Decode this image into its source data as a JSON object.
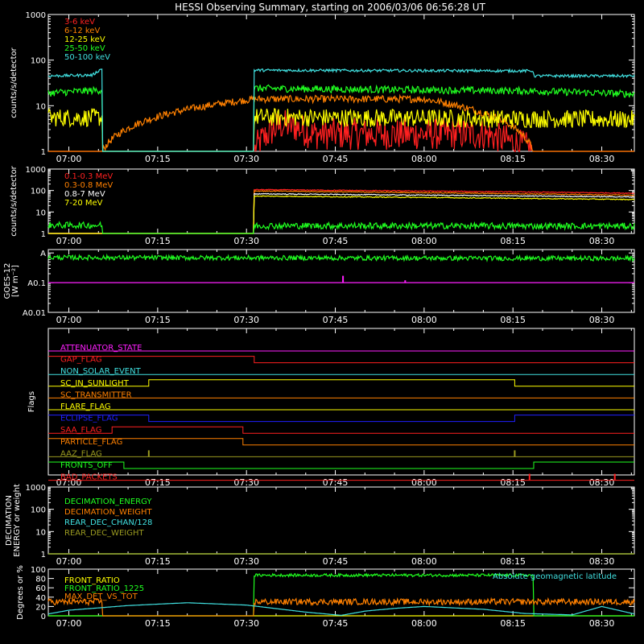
{
  "title": "HESSI Observing Summary, starting on 2006/03/06 06:56:28 UT",
  "x_axis": {
    "tick_labels": [
      "07:00",
      "07:15",
      "07:30",
      "07:45",
      "08:00",
      "08:15",
      "08:30"
    ],
    "tick_minutes": [
      0,
      15,
      30,
      45,
      60,
      75,
      90
    ],
    "range_minutes": [
      -3.47,
      95.5
    ]
  },
  "colors": {
    "red": "#ff2020",
    "orange": "#ff8000",
    "yellow": "#ffff00",
    "green": "#20ff20",
    "cyan": "#40e0e0",
    "magenta": "#ff20ff",
    "blue": "#2020ff",
    "olive": "#9a9a20",
    "white": "#ffffff",
    "salmon": "#ff7070"
  },
  "chart_data": [
    {
      "type": "line",
      "name": "lightcurves-low",
      "ylabel": "counts/s/detector",
      "yscale": "log",
      "ylim": [
        1,
        1000
      ],
      "ytick_labels": [
        "1",
        "10",
        "100",
        "1000"
      ],
      "ytick_values": [
        1,
        10,
        100,
        1000
      ],
      "series": [
        {
          "name": "3-6 keV",
          "color": "red",
          "x": [
            -3.47,
            5.6,
            31.3,
            36,
            38,
            41,
            46,
            60,
            70,
            78.5
          ],
          "y": [
            1,
            1,
            1,
            3.8,
            3.5,
            2.4,
            2.4,
            2.4,
            2.4,
            1
          ],
          "noise": 0.35
        },
        {
          "name": "6-12 keV",
          "color": "orange",
          "x": [
            -3.47,
            5.6,
            31.3,
            40,
            60,
            78.5
          ],
          "y": [
            1,
            1,
            14,
            14,
            14,
            1
          ],
          "noise": 0.08
        },
        {
          "name": "12-25 keV",
          "color": "yellow",
          "x": [
            -3.47,
            5.6,
            5.6,
            31.3,
            31.3,
            95.5
          ],
          "y": [
            5.5,
            5.5,
            1,
            1,
            5.6,
            5
          ],
          "noise": 0.2
        },
        {
          "name": "25-50 keV",
          "color": "green",
          "x": [
            -3.47,
            5.6,
            5.6,
            31.3,
            31.3,
            78.5,
            95.5
          ],
          "y": [
            19,
            22,
            1,
            1,
            24,
            21,
            18
          ],
          "noise": 0.08
        },
        {
          "name": "50-100 keV",
          "color": "cyan",
          "x": [
            -3.47,
            4,
            5.6,
            5.6,
            31.3,
            31.3,
            78.5,
            78.5,
            95.5
          ],
          "y": [
            45,
            47,
            65,
            1,
            1,
            60,
            58,
            45,
            45
          ],
          "noise": 0.03
        }
      ]
    },
    {
      "type": "line",
      "name": "lightcurves-high",
      "ylabel": "counts/s/detector",
      "yscale": "log",
      "ylim": [
        1,
        1000
      ],
      "ytick_labels": [
        "1",
        "10",
        "100",
        "1000"
      ],
      "ytick_values": [
        1,
        10,
        100,
        1000
      ],
      "series": [
        {
          "name": "0.1-0.3 MeV",
          "color": "red",
          "x": [
            -3.47,
            31.3,
            31.3,
            95.5
          ],
          "y": [
            1,
            1,
            110,
            75
          ],
          "noise": 0.02
        },
        {
          "name": "0.3-0.8 MeV",
          "color": "orange",
          "x": [
            -3.47,
            31.3,
            31.3,
            95.5
          ],
          "y": [
            1,
            1,
            95,
            60
          ],
          "noise": 0.02
        },
        {
          "name": "0.8-7 MeV",
          "color": "white",
          "x": [
            -3.47,
            31.3,
            31.3,
            95.5
          ],
          "y": [
            1,
            1,
            70,
            50
          ],
          "noise": 0.02
        },
        {
          "name": "7-20 MeV",
          "color": "yellow",
          "x": [
            -3.47,
            31.3,
            31.3,
            95.5
          ],
          "y": [
            1,
            1,
            55,
            38
          ],
          "noise": 0.02
        },
        {
          "name": "",
          "color": "green",
          "x": [
            -3.47,
            5.6,
            5.6,
            31.3,
            31.3,
            95.5
          ],
          "y": [
            2.4,
            2.4,
            1,
            1,
            2.3,
            2.2
          ],
          "noise": 0.15
        }
      ]
    },
    {
      "type": "line",
      "name": "goes",
      "ylabel": "GOES-12",
      "ylabel2": "[W m⁻²]",
      "yscale": "log",
      "ylim": [
        0.01,
        1.3
      ],
      "ytick_labels": [
        "A0.01",
        "A0.1",
        "A"
      ],
      "ytick_values": [
        0.01,
        0.1,
        1
      ],
      "series": [
        {
          "name": "",
          "color": "green",
          "x": [
            -3.47,
            95.5
          ],
          "y": [
            0.7,
            0.65
          ],
          "noise": 0.08
        },
        {
          "name": "",
          "color": "magenta",
          "x": [
            -3.47,
            95.5
          ],
          "y": [
            0.1,
            0.1
          ],
          "noise": 0
        }
      ],
      "spikes": [
        {
          "color": "magenta",
          "x": 46.3,
          "y0": 0.1,
          "y1": 0.17
        },
        {
          "color": "magenta",
          "x": 56.8,
          "y0": 0.1,
          "y1": 0.12
        }
      ]
    },
    {
      "type": "line",
      "name": "flags",
      "ylabel": "Flags",
      "flags": [
        {
          "name": "ATTENUATOR_STATE",
          "color": "magenta",
          "x": [
            -3.47,
            95.5
          ],
          "s": [
            0,
            0
          ],
          "spikes": []
        },
        {
          "name": "GAP_FLAG",
          "color": "red",
          "x": [
            -3.47,
            31.3,
            31.3,
            95.5
          ],
          "s": [
            1,
            1,
            0,
            0
          ],
          "spikes": []
        },
        {
          "name": "NON_SOLAR_EVENT",
          "color": "cyan",
          "x": [
            -3.47,
            95.5
          ],
          "s": [
            0,
            0
          ],
          "spikes": []
        },
        {
          "name": "SC_IN_SUNLIGHT",
          "color": "yellow",
          "x": [
            -3.47,
            13.5,
            13.5,
            75.3,
            75.3,
            95.5
          ],
          "s": [
            0,
            0,
            1,
            1,
            0,
            0
          ],
          "spikes": []
        },
        {
          "name": "SC_TRANSMITTER",
          "color": "orange",
          "x": [
            -3.47,
            95.5
          ],
          "s": [
            0,
            0
          ],
          "spikes": []
        },
        {
          "name": "FLARE_FLAG",
          "color": "yellow",
          "x": [
            -3.47,
            95.5
          ],
          "s": [
            0,
            0
          ],
          "spikes": []
        },
        {
          "name": "ECLIPSE_FLAG",
          "color": "blue",
          "x": [
            -3.47,
            13.5,
            13.5,
            75.3,
            75.3,
            95.5
          ],
          "s": [
            1,
            1,
            0,
            0,
            1,
            1
          ],
          "spikes": []
        },
        {
          "name": "SAA_FLAG",
          "color": "red",
          "x": [
            -3.47,
            7.3,
            7.3,
            29.4,
            29.4,
            95.5
          ],
          "s": [
            0,
            0,
            1,
            1,
            0,
            0
          ],
          "spikes": []
        },
        {
          "name": "PARTICLE_FLAG",
          "color": "orange",
          "x": [
            -3.47,
            29.4,
            29.4,
            95.5
          ],
          "s": [
            1,
            1,
            0,
            0
          ],
          "spikes": []
        },
        {
          "name": "AAZ_FLAG",
          "color": "olive",
          "x": [
            -3.47,
            95.5
          ],
          "s": [
            0,
            0
          ],
          "spikes": [
            13.5,
            75.3
          ]
        },
        {
          "name": "FRONTS_OFF",
          "color": "green",
          "x": [
            -3.47,
            9.3,
            9.3,
            78.5,
            78.5,
            95.5
          ],
          "s": [
            1,
            1,
            0,
            0,
            1,
            1
          ],
          "spikes": []
        },
        {
          "name": "BAD_PACKETS",
          "color": "red",
          "x": [
            -3.47,
            95.5
          ],
          "s": [
            0,
            0
          ],
          "spikes": [
            77.8,
            92.2
          ]
        }
      ]
    },
    {
      "type": "line",
      "name": "decimation",
      "ylabel": "DECIMATION",
      "ylabel2": "ENERGY or weight",
      "yscale": "log",
      "ylim": [
        1,
        1000
      ],
      "ytick_labels": [
        "1",
        "10",
        "100",
        "1000"
      ],
      "ytick_values": [
        1,
        10,
        100,
        1000
      ],
      "series": [
        {
          "name": "DECIMATION_ENERGY",
          "color": "green",
          "x": [
            -3.47,
            95.5
          ],
          "y": [
            1,
            1
          ],
          "noise": 0
        },
        {
          "name": "DECIMATION_WEIGHT",
          "color": "orange",
          "x": [
            -3.47,
            95.5
          ],
          "y": [
            1,
            1
          ],
          "noise": 0
        },
        {
          "name": "REAR_DEC_CHAN/128",
          "color": "cyan",
          "x": [
            -3.47,
            95.5
          ],
          "y": [
            1,
            1
          ],
          "noise": 0
        },
        {
          "name": "REAR_DEC_WEIGHT",
          "color": "olive",
          "x": [
            -3.47,
            95.5
          ],
          "y": [
            1,
            1
          ],
          "noise": 0
        }
      ]
    },
    {
      "type": "line",
      "name": "ratios",
      "ylabel": "Degrees or %",
      "yscale": "linear",
      "ylim": [
        0,
        100
      ],
      "ytick_labels": [
        "0",
        "20",
        "40",
        "60",
        "80",
        "100"
      ],
      "ytick_values": [
        0,
        20,
        40,
        60,
        80,
        100
      ],
      "note": "Absolute geomagnetic latitude",
      "series": [
        {
          "name": "FRONT_RATIO",
          "color": "yellow",
          "x": [
            -3.47,
            95.5
          ],
          "y": [
            0,
            0
          ],
          "noise": 0
        },
        {
          "name": "FRONT_RATIO_1225",
          "color": "green",
          "x": [
            -3.47,
            5.6,
            5.6,
            31.3,
            31.3,
            78.5,
            78.5,
            95.5
          ],
          "y": [
            0,
            0,
            0,
            0,
            87,
            87,
            0,
            0
          ],
          "noise": 0.035
        },
        {
          "name": "MAX_DET_VS_TOT",
          "color": "orange",
          "x": [
            -3.47,
            5.6,
            5.6,
            31.3,
            31.3,
            95.5
          ],
          "y": [
            30,
            30,
            0,
            0,
            30,
            30
          ],
          "noise": 0.22
        },
        {
          "name": "",
          "color": "cyan",
          "x": [
            -3.47,
            0,
            10,
            20,
            30,
            40,
            46,
            50,
            55,
            60,
            70,
            77,
            85,
            90,
            95.5
          ],
          "y": [
            4,
            12,
            22,
            28,
            23,
            8,
            1,
            10,
            16,
            20,
            14,
            5,
            2,
            20,
            4
          ],
          "noise": 0
        }
      ]
    }
  ]
}
